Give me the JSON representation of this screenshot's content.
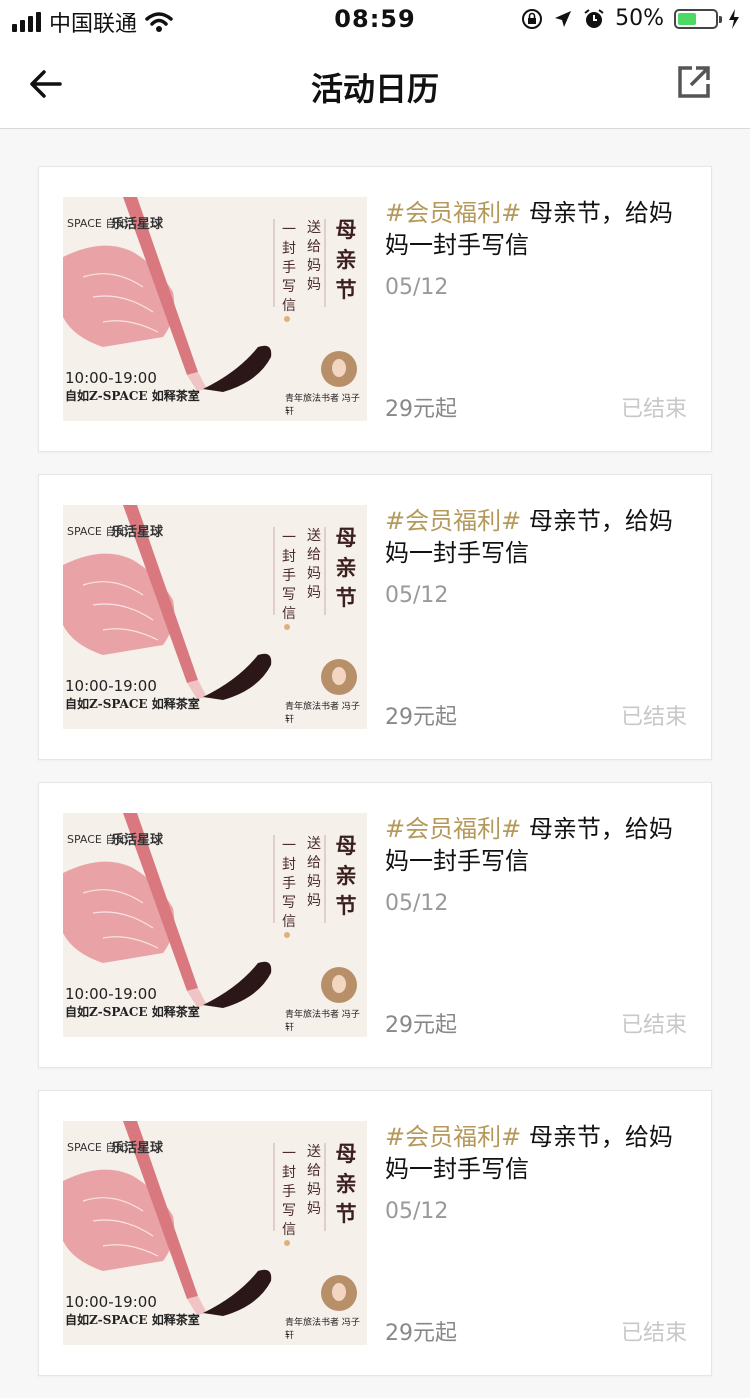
{
  "status_bar": {
    "carrier": "中国联通",
    "time": "08:59",
    "battery_percent": "50%",
    "battery_level": 0.5
  },
  "navbar": {
    "title": "活动日历",
    "back_icon": "arrow-left-icon",
    "share_icon": "external-link-icon"
  },
  "colors": {
    "tag": "#b5995a",
    "accent_pink": "#e9a3a6",
    "ink": "#2b1717"
  },
  "events": [
    {
      "tag": "#会员福利#",
      "title": "母亲节，给妈妈一封手写信",
      "date": "05/12",
      "price": "29元起",
      "status": "已结束",
      "poster": {
        "brand_left": "SPACE 自如",
        "brand_right": "乐活星球",
        "line1": "一封手写信",
        "line2": "送给妈妈",
        "line3": "母亲节",
        "time": "10:00-19:00",
        "place": "自如Z-SPACE  如释茶室",
        "author": "青年旅法书者  冯子轩"
      }
    },
    {
      "tag": "#会员福利#",
      "title": "母亲节，给妈妈一封手写信",
      "date": "05/12",
      "price": "29元起",
      "status": "已结束",
      "poster": {
        "brand_left": "SPACE 自如",
        "brand_right": "乐活星球",
        "line1": "一封手写信",
        "line2": "送给妈妈",
        "line3": "母亲节",
        "time": "10:00-19:00",
        "place": "自如Z-SPACE  如释茶室",
        "author": "青年旅法书者  冯子轩"
      }
    },
    {
      "tag": "#会员福利#",
      "title": "母亲节，给妈妈一封手写信",
      "date": "05/12",
      "price": "29元起",
      "status": "已结束",
      "poster": {
        "brand_left": "SPACE 自如",
        "brand_right": "乐活星球",
        "line1": "一封手写信",
        "line2": "送给妈妈",
        "line3": "母亲节",
        "time": "10:00-19:00",
        "place": "自如Z-SPACE  如释茶室",
        "author": "青年旅法书者  冯子轩"
      }
    },
    {
      "tag": "#会员福利#",
      "title": "母亲节，给妈妈一封手写信",
      "date": "05/12",
      "price": "29元起",
      "status": "已结束",
      "poster": {
        "brand_left": "SPACE 自如",
        "brand_right": "乐活星球",
        "line1": "一封手写信",
        "line2": "送给妈妈",
        "line3": "母亲节",
        "time": "10:00-19:00",
        "place": "自如Z-SPACE  如释茶室",
        "author": "青年旅法书者  冯子轩"
      }
    }
  ]
}
